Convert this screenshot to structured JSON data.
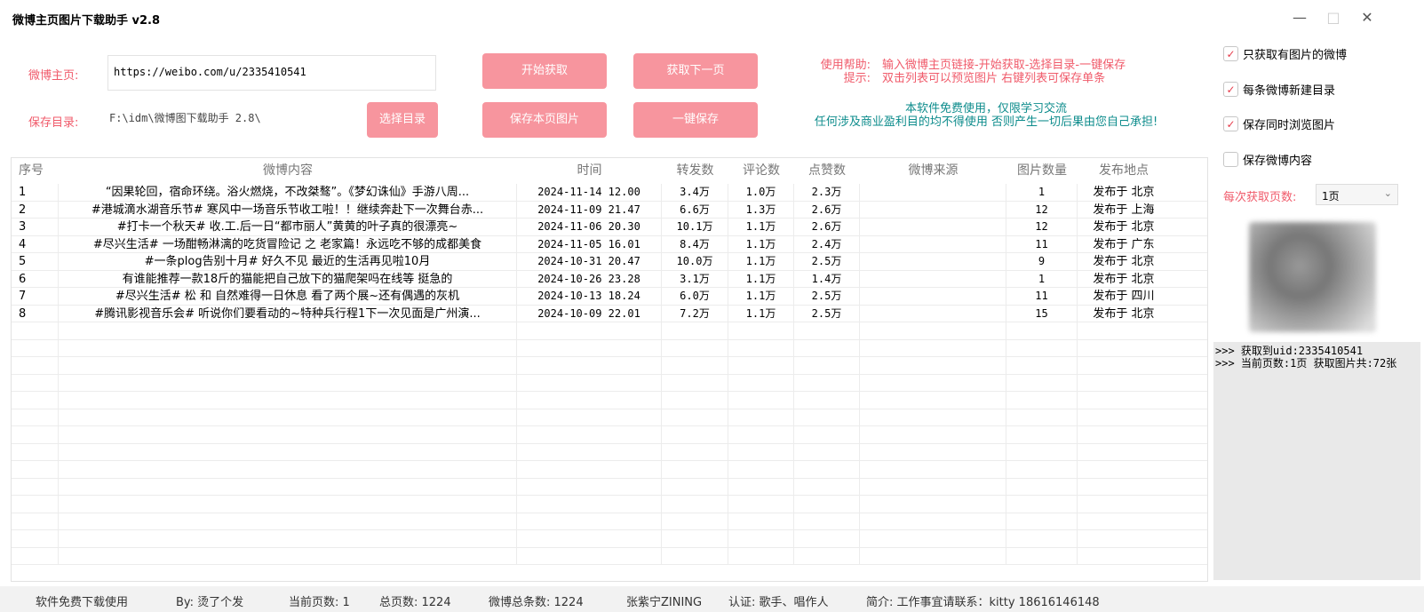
{
  "window": {
    "title": "微博主页图片下载助手 v2.8",
    "min_icon": "—",
    "max_icon": "□",
    "close_icon": "✕"
  },
  "form": {
    "home_label": "微博主页:",
    "home_value": "https://weibo.com/u/2335410541",
    "dir_label": "保存目录:",
    "dir_value": "F:\\idm\\微博图下载助手 2.8\\",
    "btn_fetch": "开始获取",
    "btn_next": "获取下一页",
    "btn_select_dir": "选择目录",
    "btn_save_page": "保存本页图片",
    "btn_save_all": "一键保存"
  },
  "help": {
    "label1": "使用帮助:",
    "text1": "输入微博主页链接-开始获取-选择目录-一键保存",
    "label2": "提示:",
    "text2": "双击列表可以预览图片 右键列表可保存单条",
    "notice1": "本软件免费使用，仅限学习交流",
    "notice2": "任何涉及商业盈利目的均不得使用 否则产生一切后果由您自己承担!"
  },
  "options": {
    "only_images": "只获取有图片的微博",
    "new_dir": "每条微博新建目录",
    "browse": "保存同时浏览图片",
    "save_content": "保存微博内容",
    "check_mark": "✓",
    "pages_label": "每次获取页数:",
    "pages_value": "1页",
    "dropdown_icon": "⌄"
  },
  "log": {
    "line1": ">>> 获取到uid:2335410541",
    "line2": ">>> 当前页数:1页 获取图片共:72张"
  },
  "table": {
    "headers": [
      "序号",
      "微博内容",
      "时间",
      "转发数",
      "评论数",
      "点赞数",
      "微博来源",
      "图片数量",
      "发布地点"
    ],
    "rows": [
      {
        "no": "1",
        "content": "“因果轮回，宿命环绕。浴火燃烧，不改桀骜”。《梦幻诛仙》手游八周...",
        "time": "2024-11-14 12.00",
        "repost": "3.4万",
        "comment": "1.0万",
        "like": "2.3万",
        "source": "",
        "images": "1",
        "location": "发布于 北京"
      },
      {
        "no": "2",
        "content": "#港城滴水湖音乐节# 寒风中一场音乐节收工啦！！继续奔赴下一次舞台赤...",
        "time": "2024-11-09 21.47",
        "repost": "6.6万",
        "comment": "1.3万",
        "like": "2.6万",
        "source": "",
        "images": "12",
        "location": "发布于 上海"
      },
      {
        "no": "3",
        "content": "#打卡一个秋天# 收.工.后一日“都市丽人”黄黄的叶子真的很漂亮~",
        "time": "2024-11-06 20.30",
        "repost": "10.1万",
        "comment": "1.1万",
        "like": "2.6万",
        "source": "",
        "images": "12",
        "location": "发布于 北京"
      },
      {
        "no": "4",
        "content": "#尽兴生活# 一场酣畅淋漓的吃货冒险记 之 老家篇！永远吃不够的成都美食",
        "time": "2024-11-05 16.01",
        "repost": "8.4万",
        "comment": "1.1万",
        "like": "2.4万",
        "source": "",
        "images": "11",
        "location": "发布于 广东"
      },
      {
        "no": "5",
        "content": "#一条plog告别十月# 好久不见 最近的生活再见啦10月",
        "time": "2024-10-31 20.47",
        "repost": "10.0万",
        "comment": "1.1万",
        "like": "2.5万",
        "source": "",
        "images": "9",
        "location": "发布于 北京"
      },
      {
        "no": "6",
        "content": "有谁能推荐一款18斤的猫能把自己放下的猫爬架吗在线等 挺急的",
        "time": "2024-10-26 23.28",
        "repost": "3.1万",
        "comment": "1.1万",
        "like": "1.4万",
        "source": "",
        "images": "1",
        "location": "发布于 北京"
      },
      {
        "no": "7",
        "content": "#尽兴生活# 松 和 自然难得一日休息 看了两个展~还有偶遇的灰机",
        "time": "2024-10-13 18.24",
        "repost": "6.0万",
        "comment": "1.1万",
        "like": "2.5万",
        "source": "",
        "images": "11",
        "location": "发布于 四川"
      },
      {
        "no": "8",
        "content": "#腾讯影视音乐会# 听说你们要看动的~特种兵行程1下一次见面是广州演...",
        "time": "2024-10-09 22.01",
        "repost": "7.2万",
        "comment": "1.1万",
        "like": "2.5万",
        "source": "",
        "images": "15",
        "location": "发布于 北京"
      }
    ]
  },
  "statusbar": {
    "free": "软件免费下载使用",
    "by": "By: 烫了个发",
    "current_page": "当前页数: 1",
    "total_pages": "总页数: 1224",
    "total_posts": "微博总条数: 1224",
    "user": "张紫宁ZINING",
    "verify": "认证: 歌手、唱作人",
    "intro": "简介: 工作事宜请联系：kitty 18616146148"
  },
  "colors": {
    "accent_pink": "#f7959e",
    "label_red": "#f05a6a",
    "notice_teal": "#0d8c8c"
  }
}
